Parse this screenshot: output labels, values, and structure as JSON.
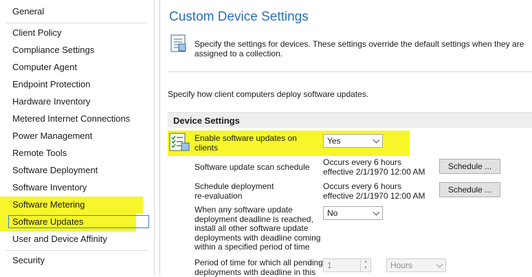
{
  "sidebar": {
    "items": [
      {
        "label": "General"
      },
      {
        "label": "Client Policy"
      },
      {
        "label": "Compliance Settings"
      },
      {
        "label": "Computer Agent"
      },
      {
        "label": "Endpoint Protection"
      },
      {
        "label": "Hardware Inventory"
      },
      {
        "label": "Metered Internet Connections"
      },
      {
        "label": "Power Management"
      },
      {
        "label": "Remote Tools"
      },
      {
        "label": "Software Deployment"
      },
      {
        "label": "Software Inventory"
      },
      {
        "label": "Software Metering"
      },
      {
        "label": "Software Updates"
      },
      {
        "label": "User and Device Affinity"
      },
      {
        "label": "Security"
      }
    ],
    "selected": "Software Updates"
  },
  "main": {
    "title": "Custom Device Settings",
    "intro_line1": "Specify the settings for devices. These settings override the default settings when they are",
    "intro_line2": "assigned to a collection.",
    "group_description": "Specify how client computers deploy software updates.",
    "section_header": "Device Settings",
    "settings": {
      "enable": {
        "label_line1": "Enable software updates on",
        "label_line2": "clients",
        "value": "Yes"
      },
      "scan": {
        "label": "Software update scan schedule",
        "value_line1": "Occurs every 6 hours",
        "value_line2": "effective 2/1/1970 12:00 AM",
        "button": "Schedule ..."
      },
      "reeval": {
        "label_line1": "Schedule deployment",
        "label_line2": "re-evaluation",
        "value_line1": "Occurs every 6 hours",
        "value_line2": "effective 2/1/1970 12:00 AM",
        "button": "Schedule ..."
      },
      "deadline": {
        "label_lines": [
          "When any software update",
          "deployment deadline is reached,",
          "install all other software update",
          "deployments with deadline coming",
          "within a specified period of time"
        ],
        "value": "No"
      },
      "period": {
        "label_line1": "Period of time for which all pending",
        "label_line2": "deployments with deadline in this",
        "number": "1",
        "unit": "Hours"
      }
    }
  },
  "colors": {
    "title": "#2a6fbb",
    "highlight": "#f6f62a",
    "selection_border": "#3c7fd1"
  },
  "icons": [
    "settings-document-icon",
    "settings-checklist-icon",
    "chevron-down-icon",
    "spinner-arrows-icon"
  ]
}
